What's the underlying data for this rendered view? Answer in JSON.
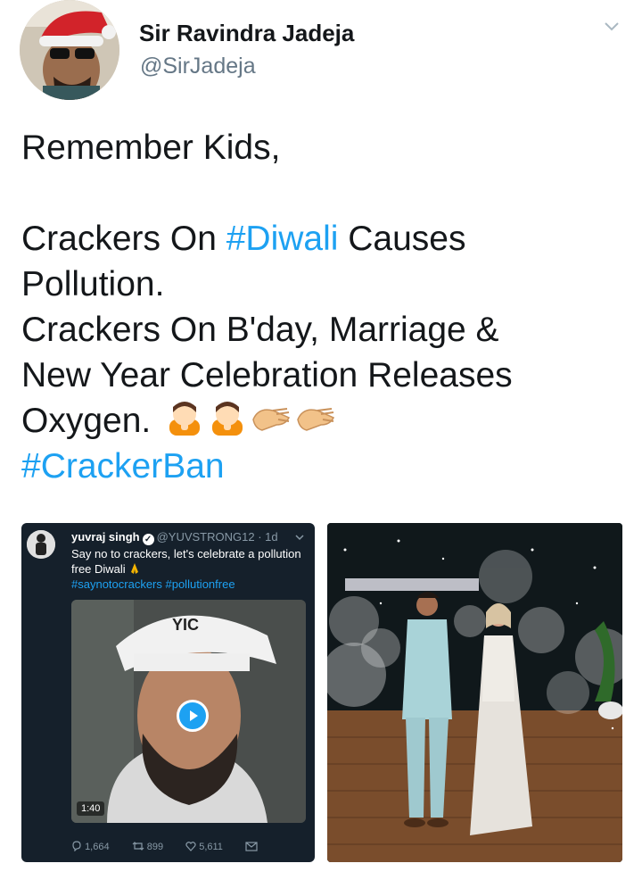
{
  "author": {
    "name": "Sir Ravindra Jadeja",
    "handle": "@SirJadeja"
  },
  "tweet": {
    "line1": "Remember Kids,",
    "line2_pre": "Crackers On ",
    "line2_tag": "#Diwali",
    "line2_post": " Causes",
    "line3": "Pollution.",
    "line4": "Crackers On B'day, Marriage &",
    "line5": "New Year Celebration Releases",
    "line6": "Oxygen.",
    "hashtag": "#CrackerBan",
    "emojis": [
      "person-bowing-icon",
      "person-bowing-icon",
      "clapping-hand-icon",
      "clapping-hand-icon"
    ]
  },
  "embedded_tweet": {
    "name": "yuvraj singh",
    "handle": "@YUVSTRONG12",
    "time": "· 1d",
    "text": "Say no to crackers, let's celebrate a pollution free Diwali",
    "tags": "#saynotocrackers #pollutionfree",
    "video_duration": "1:40",
    "replies": "1,664",
    "retweets": "899",
    "likes": "5,611",
    "cap_text": "YIC"
  },
  "colors": {
    "link": "#1da1f2",
    "handle": "#657786",
    "dark_card": "#15202b"
  }
}
